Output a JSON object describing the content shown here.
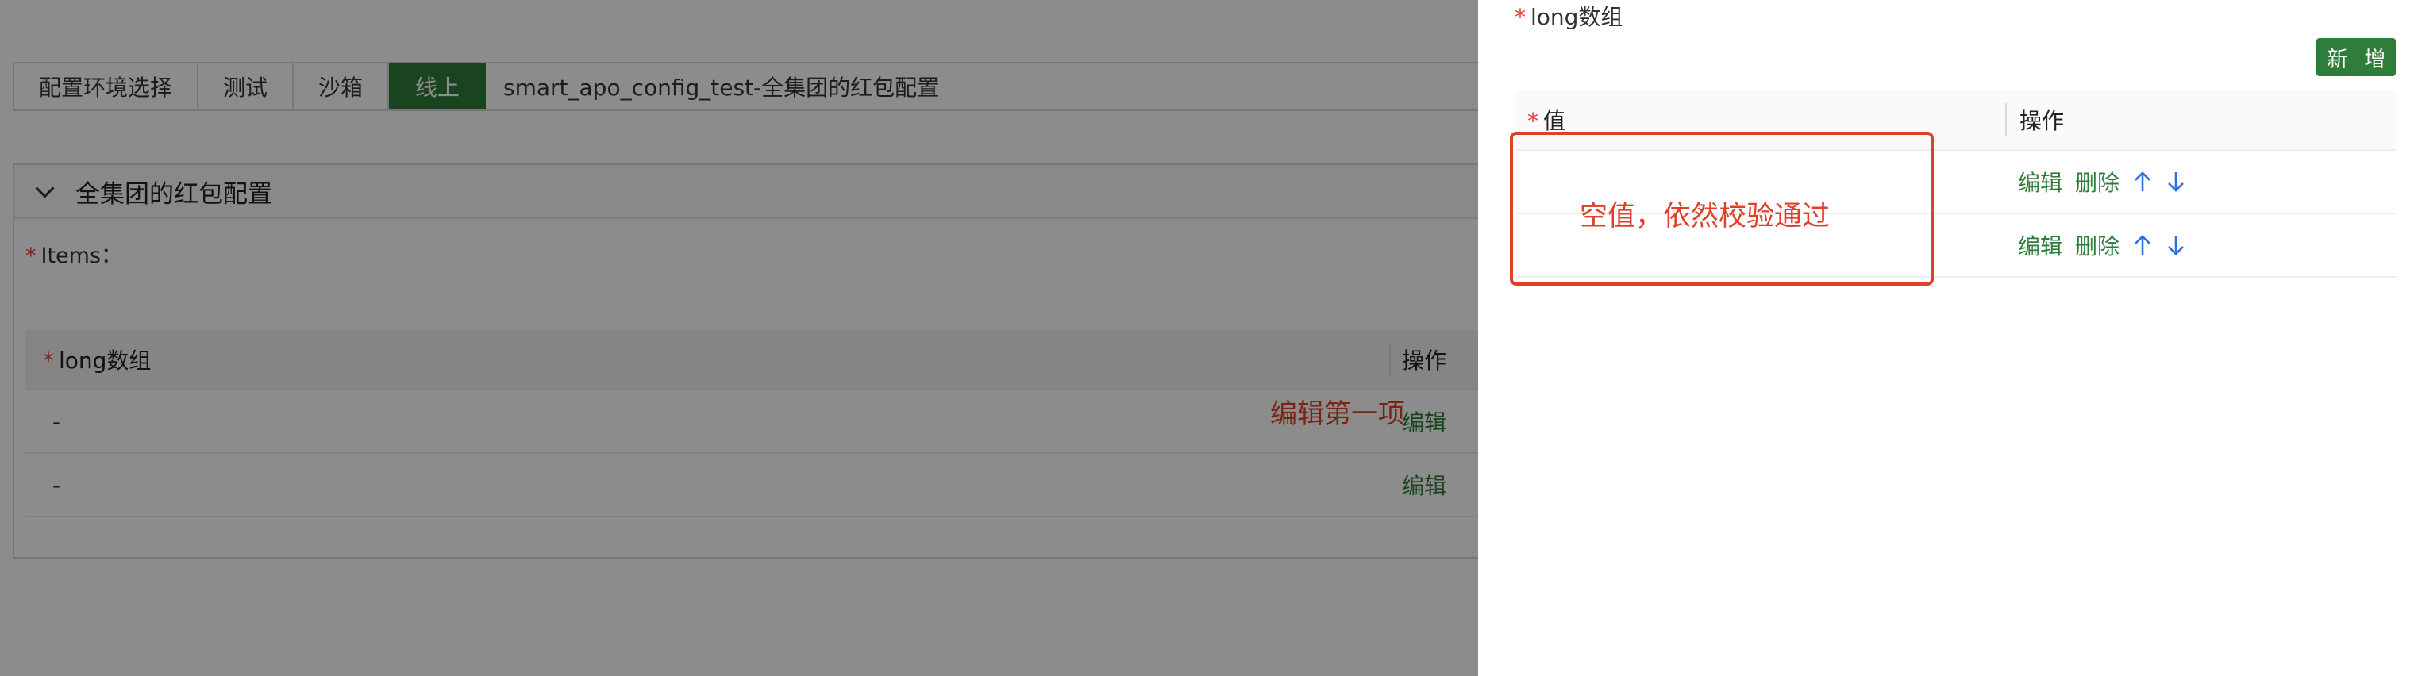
{
  "env_bar": {
    "label": "配置环境选择",
    "envs": [
      "测试",
      "沙箱",
      "线上"
    ],
    "active_env": "线上",
    "config_name": "smart_apo_config_test-全集团的红包配置"
  },
  "panel": {
    "title": "全集团的红包配置",
    "items_label": "Items：",
    "table": {
      "headers": [
        "long数组",
        "操作"
      ],
      "rows": [
        {
          "value": "-",
          "action": "编辑"
        },
        {
          "value": "-",
          "action": "编辑"
        }
      ]
    }
  },
  "annotations": {
    "edit_first": "编辑第一项",
    "empty_value": "空值，依然校验通过"
  },
  "drawer": {
    "field_label": "long数组",
    "add_button": "新 增",
    "table": {
      "headers": [
        "值",
        "操作"
      ],
      "rows": [
        {
          "value": "",
          "edit": "编辑",
          "delete": "删除",
          "up_icon": "arrow-up-icon",
          "down_icon": "arrow-down-icon"
        },
        {
          "value": "",
          "edit": "编辑",
          "delete": "删除",
          "up_icon": "arrow-up-icon",
          "down_icon": "arrow-down-icon"
        }
      ]
    }
  },
  "colors": {
    "accent": "#2e7d3a",
    "annotation": "#e0402a",
    "required": "#e0403a",
    "arrow": "#2f6fe0"
  }
}
